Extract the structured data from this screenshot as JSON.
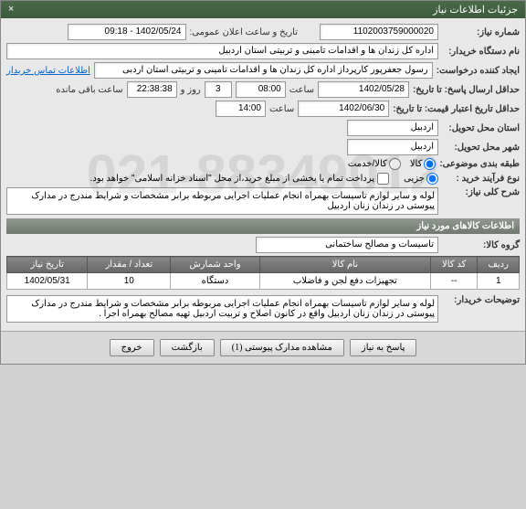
{
  "titlebar": {
    "title": "جزئیات اطلاعات نیاز",
    "close": "×"
  },
  "watermark": "021-88349012",
  "fields": {
    "need_no_lbl": "شماره نیاز:",
    "need_no": "1102003759000020",
    "announce_lbl": "تاریخ و ساعت اعلان عمومی:",
    "announce": "1402/05/24 - 09:18",
    "buyer_lbl": "نام دستگاه خریدار:",
    "buyer": "اداره کل زندان ها و اقدامات تامینی و تربیتی استان اردبیل",
    "requester_lbl": "ایجاد کننده درخواست:",
    "requester": "رسول جعفرپور  کارپرداز اداره کل زندان ها و اقدامات تامینی و تربیتی استان اردبی",
    "contact_link": "اطلاعات تماس خریدار",
    "min_resp_lbl": "حداقل ارسال پاسخ: تا تاریخ:",
    "min_resp_date": "1402/05/28",
    "time_lbl": "ساعت",
    "min_resp_time": "08:00",
    "day_lbl": "روز و",
    "days": "3",
    "remain_time": "22:38:38",
    "remain_lbl": "ساعت باقی مانده",
    "deadline_lbl": "حداقل تاریخ اعتبار قیمت: تا تاریخ:",
    "deadline_date": "1402/06/30",
    "deadline_time": "14:00",
    "exec_loc_lbl": "استان محل تحویل:",
    "exec_loc": "اردبیل",
    "deliv_city_lbl": "شهر محل تحویل:",
    "deliv_city": "اردبیل",
    "cat_lbl": "طبقه بندی موضوعی:",
    "cat_goods": "کالا",
    "cat_svc": "کالا/خدمت",
    "proc_lbl": "نوع فرآیند خرید :",
    "proc_buy": "جزیی",
    "proc_pay": "پرداخت تمام یا بخشی از مبلغ خرید،از محل \"اسناد خزانه اسلامی\" خواهد بود.",
    "desc_lbl": "شرح کلی نیاز:",
    "desc": "لوله  و سایر لوازم تاسیسات  بهمراه انجام عملیات اجرایی مربوطه برابر مشخصات و شرایط مندرج در مدارک پیوستی در زندان زنان  اردبیل",
    "items_hdr": "اطلاعات کالاهای مورد نیاز",
    "grp_lbl": "گروه کالا:",
    "grp": "تاسیسات و مصالح ساختمانی",
    "buyer_notes_lbl": "توضیحات خریدار:",
    "buyer_notes": "لوله  و سایر لوازم تاسیسات  بهمراه انجام عملیات اجرایی مربوطه برابر مشخصات و شرایط مندرج در مدارک پیوستی در زندان زنان  اردبیل واقع در کانون اصلاح و تربیت اردبیل تهیه مصالح بهمراه اجرا ."
  },
  "table": {
    "headers": {
      "row": "ردیف",
      "code": "کد کالا",
      "name": "نام کالا",
      "unit": "واحد شمارش",
      "qty": "تعداد / مقدار",
      "date": "تاریخ نیاز"
    },
    "rows": [
      {
        "row": "1",
        "code": "--",
        "name": "تجهیزات دفع لجن و فاضلاب",
        "unit": "دستگاه",
        "qty": "10",
        "date": "1402/05/31"
      }
    ]
  },
  "buttons": {
    "respond": "پاسخ به نیاز",
    "attach": "مشاهده مدارک پیوستی (1)",
    "back": "بازگشت",
    "exit": "خروج"
  }
}
